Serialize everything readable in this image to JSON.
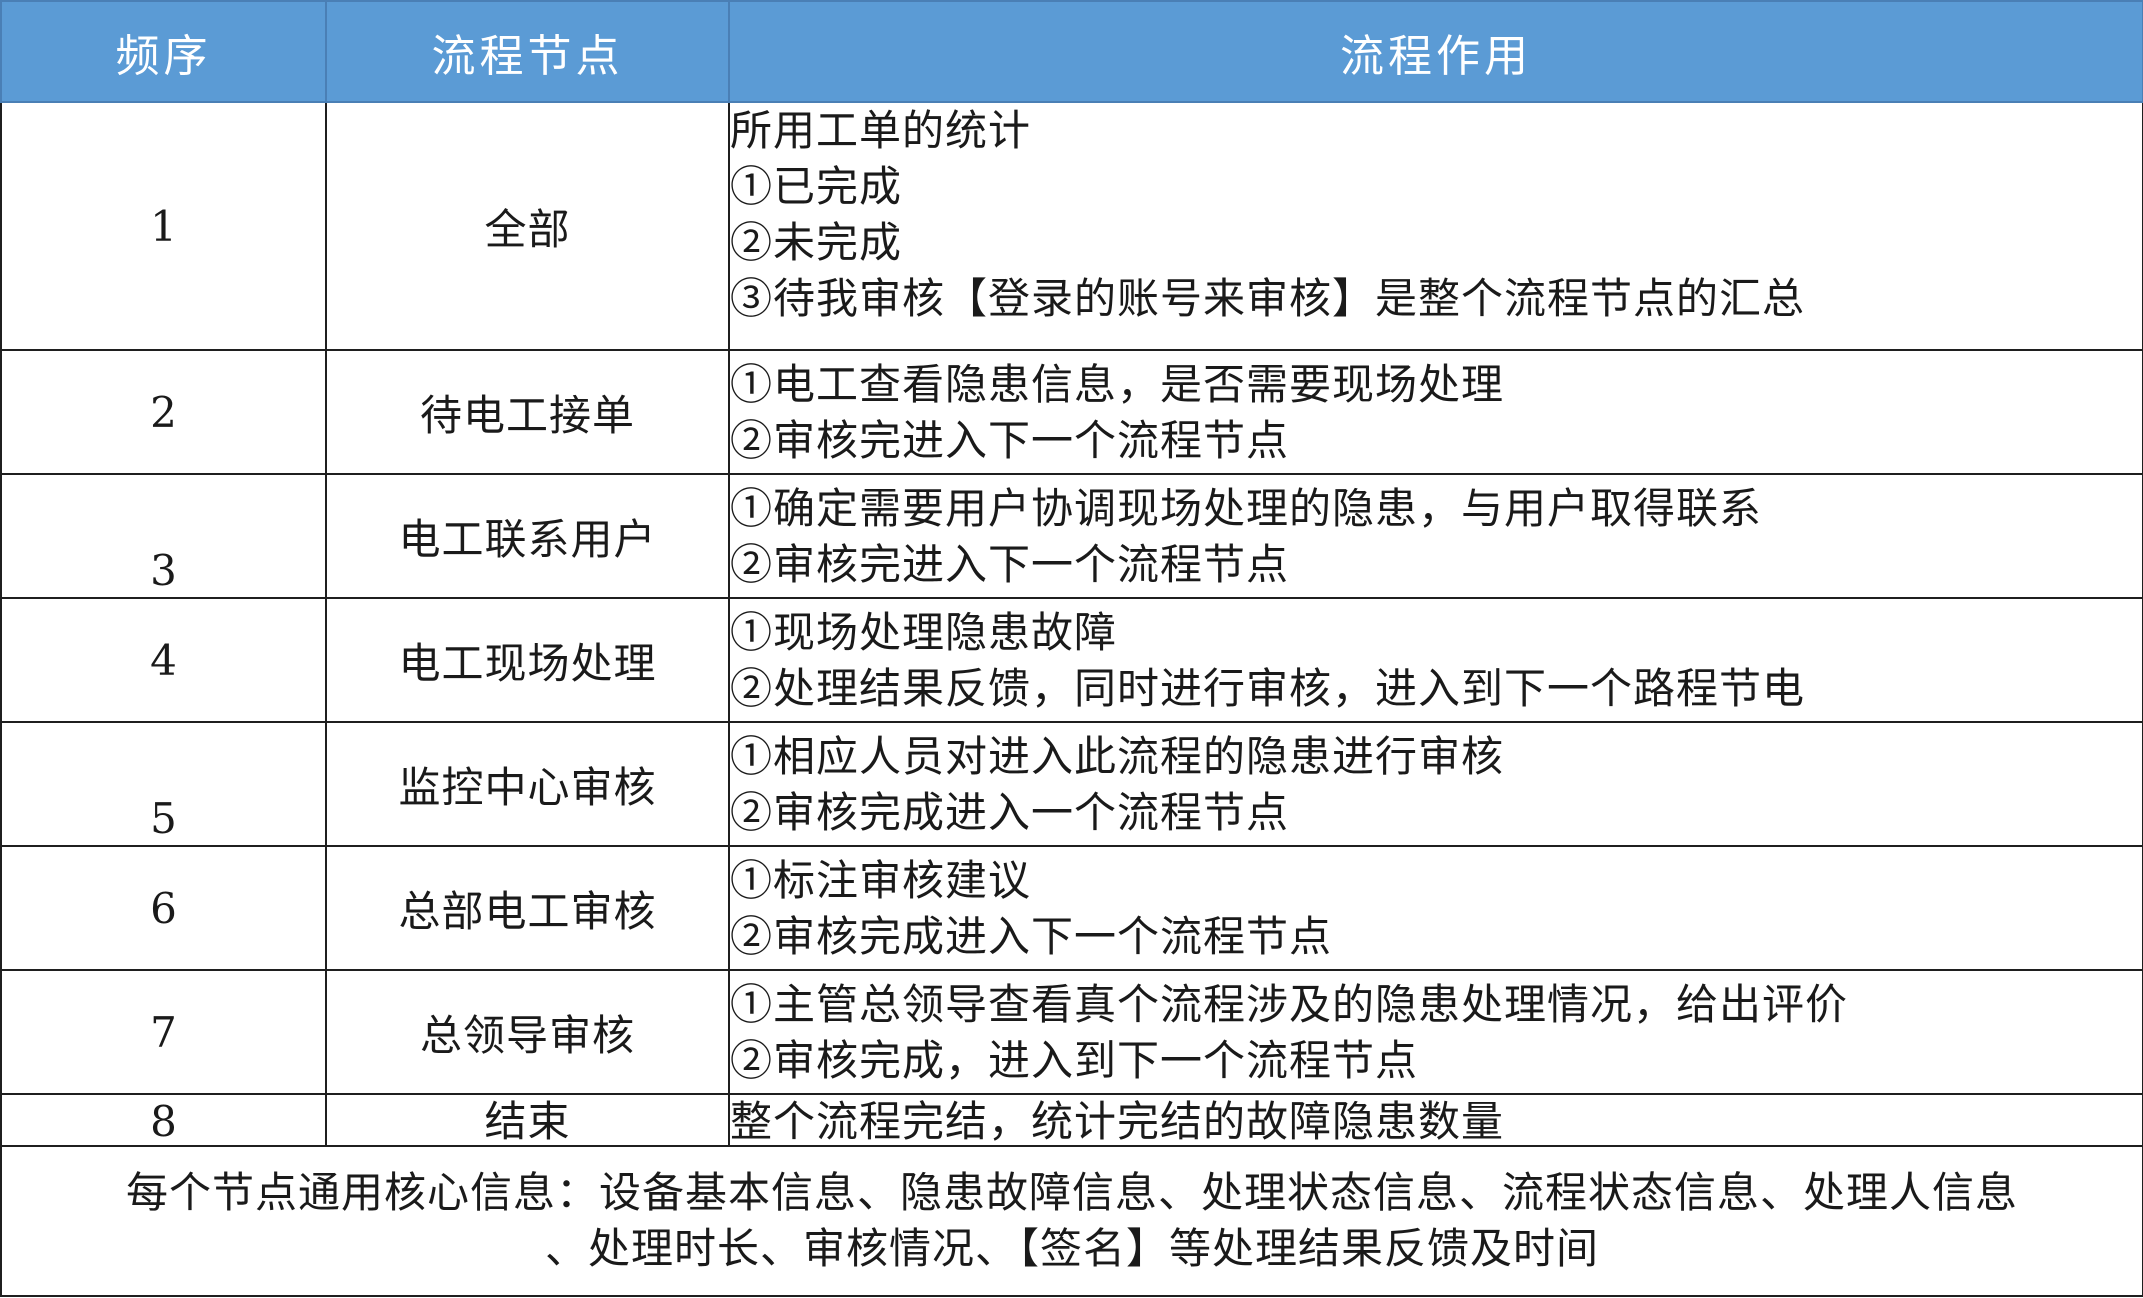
{
  "header": {
    "col_seq": "频序",
    "col_node": "流程节点",
    "col_func": "流程作用"
  },
  "rows": [
    {
      "seq": "1",
      "node": "全部",
      "lines": [
        "所用工单的统计",
        "①已完成",
        "②未完成",
        "③待我审核【登录的账号来审核】是整个流程节点的汇总"
      ]
    },
    {
      "seq": "2",
      "node": "待电工接单",
      "lines": [
        "①电工查看隐患信息，是否需要现场处理",
        "②审核完进入下一个流程节点"
      ]
    },
    {
      "seq": "3",
      "node": "电工联系用户",
      "lines": [
        "①确定需要用户协调现场处理的隐患，与用户取得联系",
        "②审核完进入下一个流程节点"
      ]
    },
    {
      "seq": "4",
      "node": "电工现场处理",
      "lines": [
        "①现场处理隐患故障",
        "②处理结果反馈，同时进行审核，进入到下一个路程节电"
      ]
    },
    {
      "seq": "5",
      "node": "监控中心审核",
      "lines": [
        "①相应人员对进入此流程的隐患进行审核",
        "②审核完成进入一个流程节点"
      ]
    },
    {
      "seq": "6",
      "node": "总部电工审核",
      "lines": [
        "①标注审核建议",
        "②审核完成进入下一个流程节点"
      ]
    },
    {
      "seq": "7",
      "node": "总领导审核",
      "lines": [
        "①主管总领导查看真个流程涉及的隐患处理情况，给出评价",
        "②审核完成，进入到下一个流程节点"
      ]
    },
    {
      "seq": "8",
      "node": "结束",
      "lines": [
        "整个流程完结，统计完结的故障隐患数量"
      ]
    }
  ],
  "footer": {
    "line1": "每个节点通用核心信息：设备基本信息、隐患故障信息、处理状态信息、流程状态信息、处理人信息",
    "line2": "、处理时长、审核情况、【签名】等处理结果反馈及时间"
  }
}
